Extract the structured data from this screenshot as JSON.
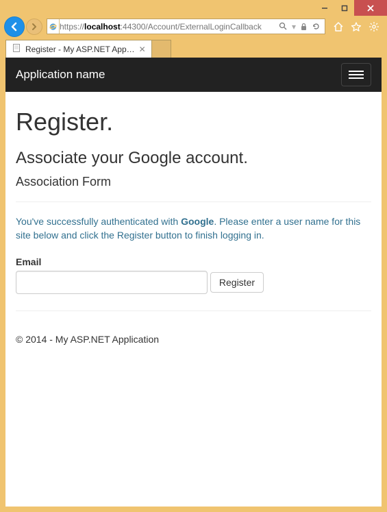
{
  "window": {
    "url_scheme": "https://",
    "url_host": "localhost",
    "url_port": ":44300",
    "url_path": "/Account/ExternalLoginCallback"
  },
  "tab": {
    "title": "Register - My ASP.NET App…"
  },
  "navbar": {
    "brand": "Application name"
  },
  "page": {
    "title": "Register.",
    "subtitle": "Associate your Google account.",
    "formTitle": "Association Form",
    "info_pre": "You've successfully authenticated with ",
    "info_provider": "Google",
    "info_post": ". Please enter a user name for this site below and click the Register button to finish logging in.",
    "emailLabel": "Email",
    "registerBtn": "Register"
  },
  "footer": {
    "copyright": "© 2014 - My ASP.NET Application"
  },
  "addr_glyphs": {
    "search": "⍴",
    "lock": "ὑ2",
    "refresh": "↻"
  }
}
